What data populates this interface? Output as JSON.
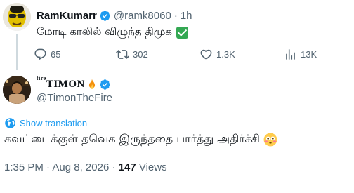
{
  "reply": {
    "display_name": "RamKumarr",
    "handle": "@ramk8060",
    "separator": "·",
    "time": "1h",
    "text": "மோடி காலில் விழுந்த திமுக",
    "text_emoji": "check-mark-emoji",
    "actions": {
      "replies": "65",
      "reposts": "302",
      "likes": "1.3K",
      "views": "13K"
    }
  },
  "main": {
    "display_name_prefix": "fire",
    "display_name": "TIMON",
    "name_emoji": "fire-emoji",
    "handle": "@TimonTheFire",
    "translate_label": "Show translation",
    "text": "கவட்டைக்குள் தவெக இருந்ததை பார்த்து அதிர்ச்சி",
    "text_emoji": "flushed-face-emoji",
    "meta": {
      "time": "1:35 PM",
      "separator1": " · ",
      "date": "Aug 8, 2026",
      "separator2": " · ",
      "views_count": "147",
      "views_label": " Views"
    }
  },
  "colors": {
    "text": "#0f1419",
    "secondary": "#536471",
    "accent": "#1d9bf0",
    "thread_line": "#cfd9de"
  }
}
